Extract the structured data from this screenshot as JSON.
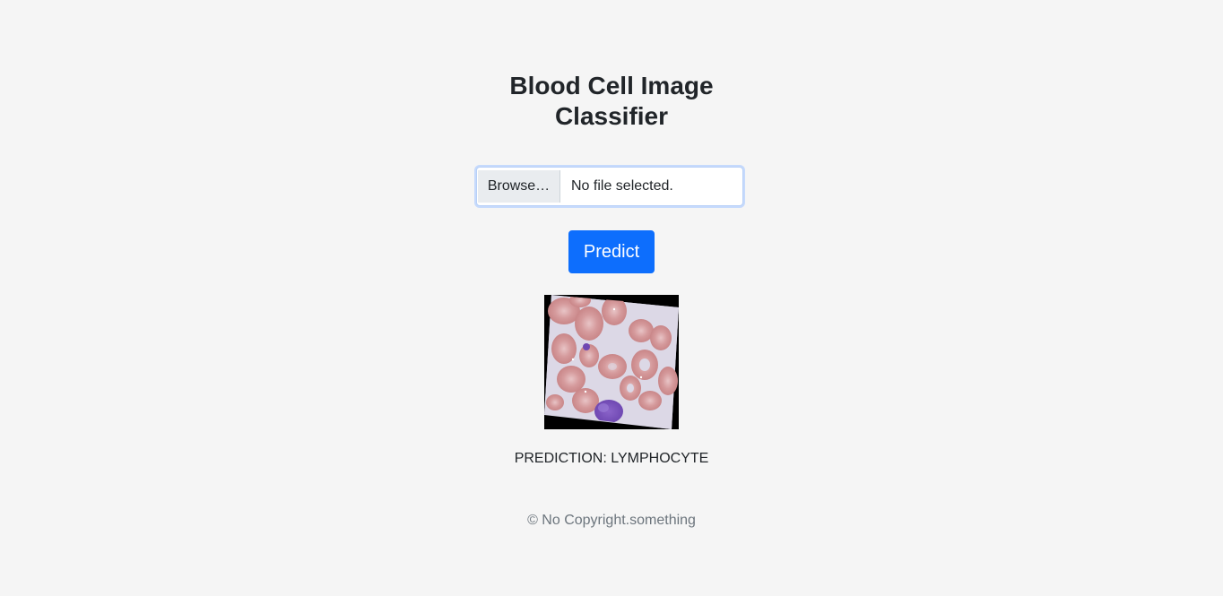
{
  "page": {
    "title": "Blood Cell Image Classifier"
  },
  "upload": {
    "browse_label": "Browse…",
    "status": "No file selected."
  },
  "actions": {
    "predict_label": "Predict"
  },
  "result": {
    "prediction_text": "PREDICTION: LYMPHOCYTE"
  },
  "footer": {
    "text": "© No Copyright.something"
  },
  "colors": {
    "background": "#f5f5f5",
    "primary": "#0d6efd",
    "muted": "#6c757d"
  }
}
